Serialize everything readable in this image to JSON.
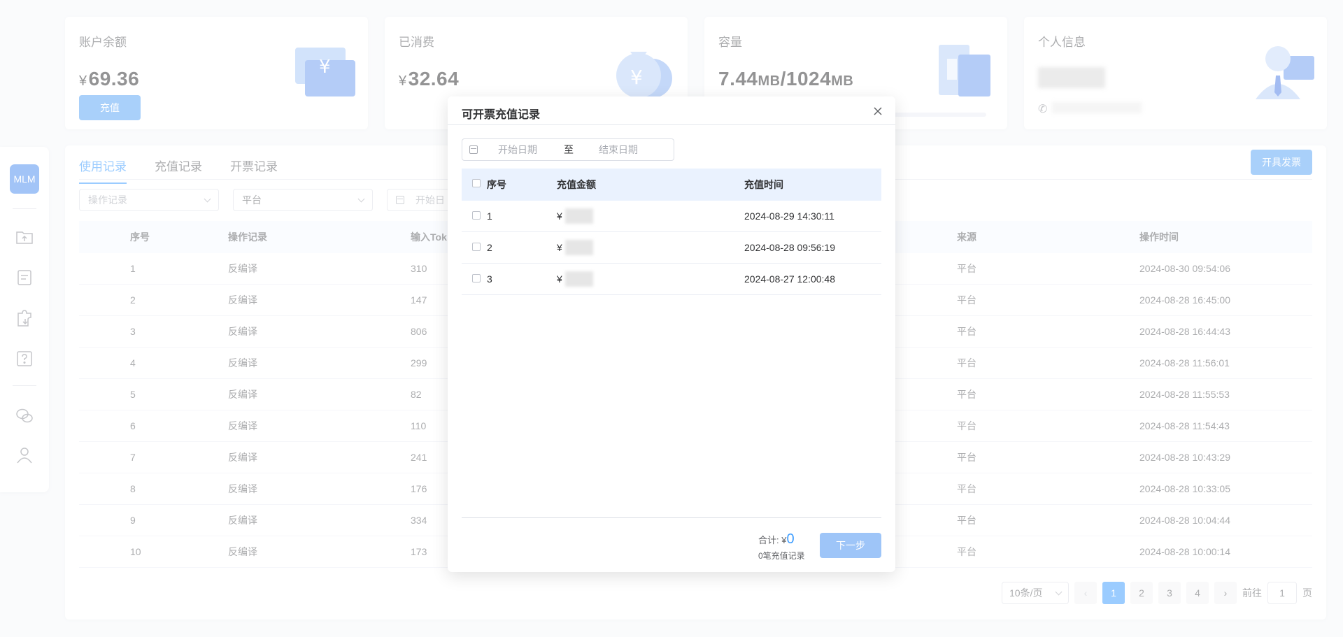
{
  "cards": {
    "balance": {
      "title": "账户余额",
      "currency": "¥",
      "value": "69.36",
      "button": "充值"
    },
    "spent": {
      "title": "已消费",
      "currency": "¥",
      "value": "32.64"
    },
    "capacity": {
      "title": "容量",
      "used": "7.44",
      "used_unit": "MB",
      "sep": "/",
      "total": "1024",
      "total_unit": "MB"
    },
    "profile": {
      "title": "个人信息"
    }
  },
  "sidebar": {
    "logo": "MLM"
  },
  "tabs": [
    "使用记录",
    "充值记录",
    "开票记录"
  ],
  "invoice_button": "开具发票",
  "filters": {
    "operation": "操作记录",
    "platform": "平台",
    "date_start": "开始日"
  },
  "table": {
    "columns": [
      "序号",
      "操作记录",
      "输入Tok",
      "来源",
      "操作时间"
    ],
    "rows": [
      [
        "1",
        "反编译",
        "310",
        "平台",
        "2024-08-30 09:54:06"
      ],
      [
        "2",
        "反编译",
        "147",
        "平台",
        "2024-08-28 16:45:00"
      ],
      [
        "3",
        "反编译",
        "806",
        "平台",
        "2024-08-28 16:44:43"
      ],
      [
        "4",
        "反编译",
        "299",
        "平台",
        "2024-08-28 11:56:01"
      ],
      [
        "5",
        "反编译",
        "82",
        "平台",
        "2024-08-28 11:55:53"
      ],
      [
        "6",
        "反编译",
        "110",
        "平台",
        "2024-08-28 11:54:43"
      ],
      [
        "7",
        "反编译",
        "241",
        "平台",
        "2024-08-28 10:43:29"
      ],
      [
        "8",
        "反编译",
        "176",
        "平台",
        "2024-08-28 10:33:05"
      ],
      [
        "9",
        "反编译",
        "334",
        "平台",
        "2024-08-28 10:04:44"
      ],
      [
        "10",
        "反编译",
        "173",
        "平台",
        "2024-08-28 10:00:14"
      ]
    ]
  },
  "pagination": {
    "page_size": "10条/页",
    "pages": [
      "1",
      "2",
      "3",
      "4"
    ],
    "current": "1",
    "goto_label": "前往",
    "goto_value": "1",
    "page_suffix": "页"
  },
  "modal": {
    "title": "可开票充值记录",
    "date_start_placeholder": "开始日期",
    "date_to": "至",
    "date_end_placeholder": "结束日期",
    "columns": [
      "序号",
      "充值金额",
      "充值时间"
    ],
    "rows": [
      {
        "index": "1",
        "amount_prefix": "¥",
        "time": "2024-08-29 14:30:11"
      },
      {
        "index": "2",
        "amount_prefix": "¥",
        "time": "2024-08-28 09:56:19"
      },
      {
        "index": "3",
        "amount_prefix": "¥",
        "time": "2024-08-27 12:00:48"
      }
    ],
    "total_label": "合计:",
    "total_currency": "¥",
    "total_value": "0",
    "count_text": "0笔充值记录",
    "next_button": "下一步"
  }
}
